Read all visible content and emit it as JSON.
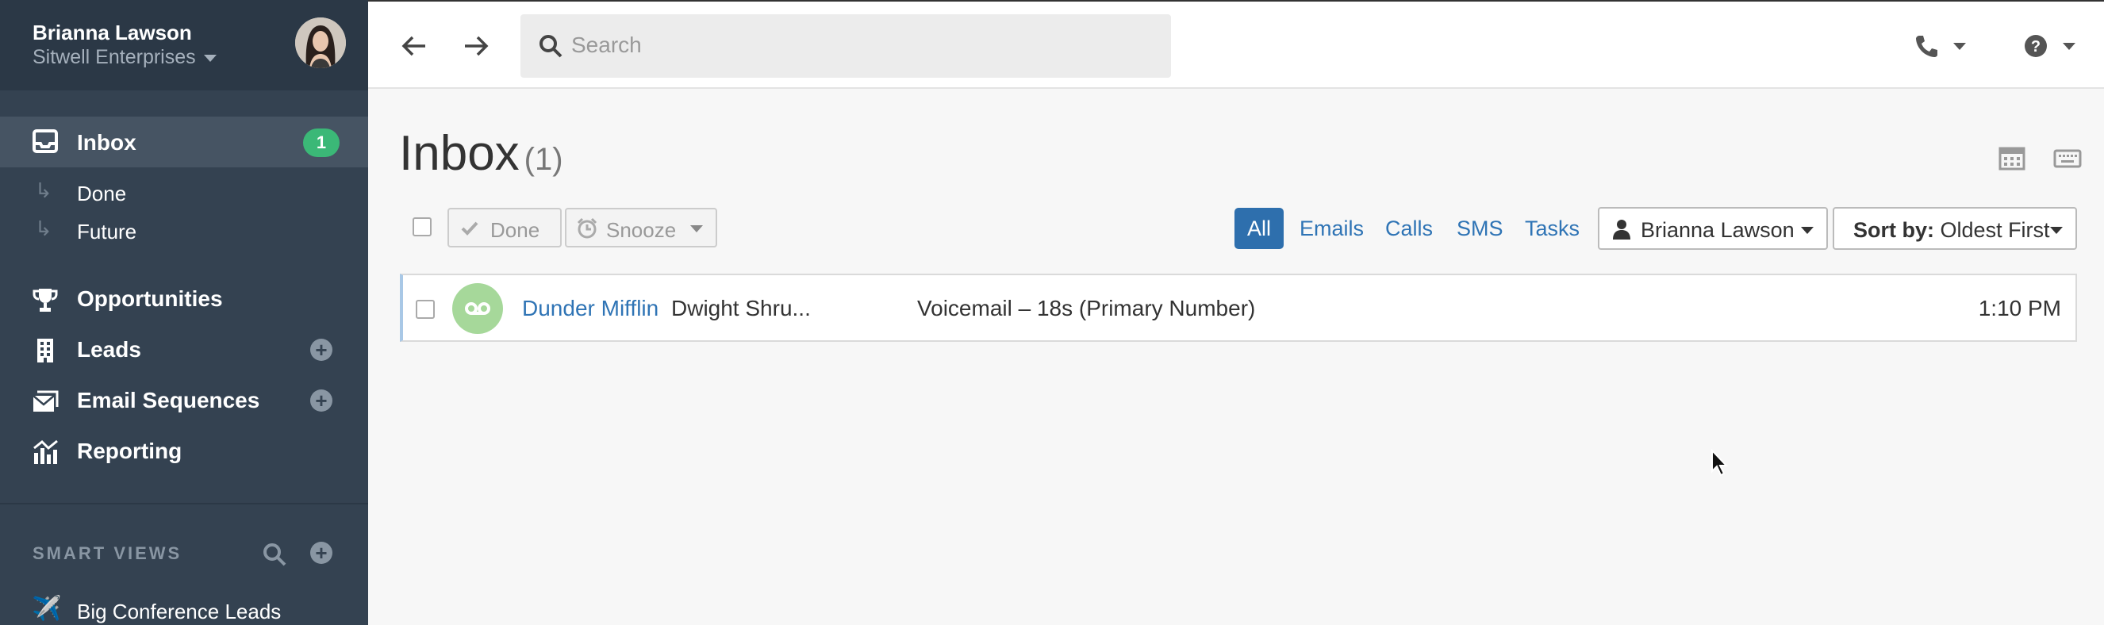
{
  "sidebar": {
    "user_name": "Brianna Lawson",
    "org_name": "Sitwell Enterprises",
    "inbox": {
      "label": "Inbox",
      "badge": "1"
    },
    "sub_items": [
      {
        "label": "Done"
      },
      {
        "label": "Future"
      }
    ],
    "items": [
      {
        "label": "Opportunities",
        "icon": "trophy-icon"
      },
      {
        "label": "Leads",
        "icon": "building-icon"
      },
      {
        "label": "Email Sequences",
        "icon": "envelope-stack-icon"
      },
      {
        "label": "Reporting",
        "icon": "chart-icon"
      }
    ],
    "smart_views": {
      "title": "SMART VIEWS",
      "items": [
        {
          "label": "Big Conference Leads",
          "icon": "airplane-icon"
        }
      ]
    }
  },
  "topbar": {
    "search_placeholder": "Search"
  },
  "main": {
    "title": "Inbox",
    "count": "(1)",
    "toolbar": {
      "done_label": "Done",
      "snooze_label": "Snooze"
    },
    "filters": [
      {
        "label": "All",
        "active": true
      },
      {
        "label": "Emails",
        "active": false
      },
      {
        "label": "Calls",
        "active": false
      },
      {
        "label": "SMS",
        "active": false
      },
      {
        "label": "Tasks",
        "active": false
      }
    ],
    "user_filter": "Brianna Lawson",
    "sort": {
      "prefix": "Sort by:",
      "value": "Oldest First"
    },
    "rows": [
      {
        "company": "Dunder Mifflin",
        "contact": "Dwight Shru...",
        "description": "Voicemail – 18s (Primary Number)",
        "time": "1:10 PM"
      }
    ]
  },
  "colors": {
    "sidebar_bg": "#344251",
    "accent_blue": "#2e6fad",
    "badge_green": "#3bb877",
    "voicemail_green": "#a6d89a"
  }
}
